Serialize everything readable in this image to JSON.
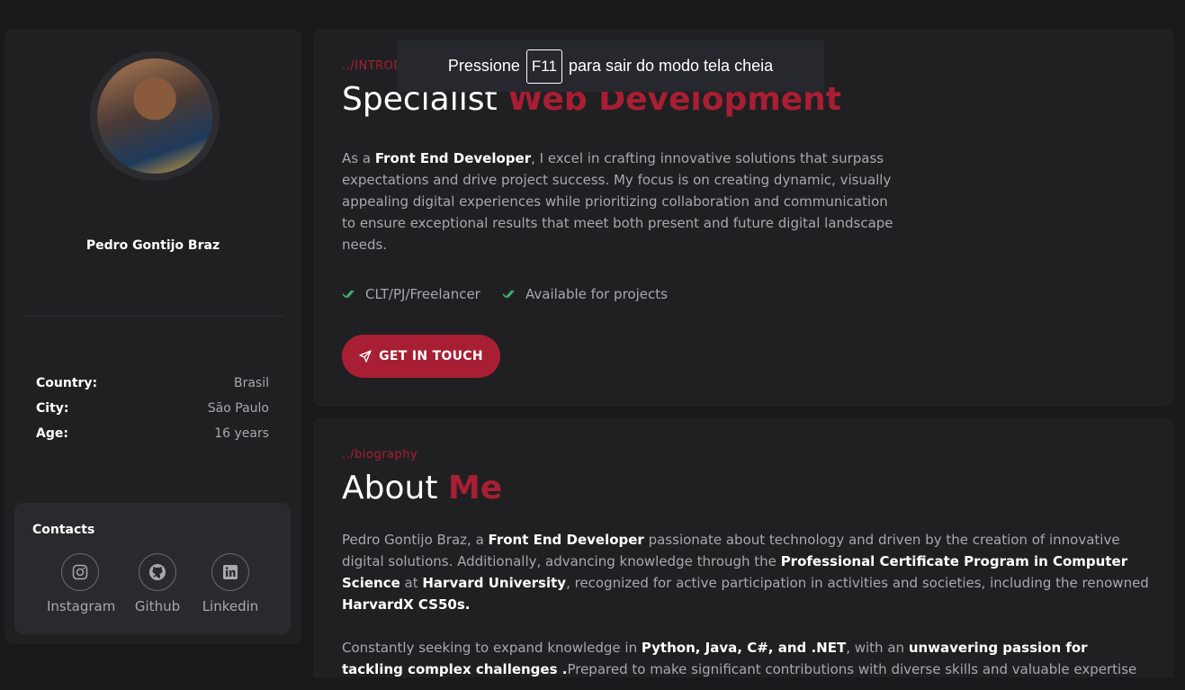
{
  "sidebar": {
    "name": "Pedro Gontijo Braz",
    "info": [
      {
        "label": "Country:",
        "value": "Brasil"
      },
      {
        "label": "City:",
        "value": "São Paulo"
      },
      {
        "label": "Age:",
        "value": "16 years"
      }
    ],
    "contacts_title": "Contacts",
    "socials": [
      {
        "label": "Instagram",
        "icon": "instagram-icon"
      },
      {
        "label": "Github",
        "icon": "github-icon"
      },
      {
        "label": "Linkedin",
        "icon": "linkedin-icon"
      }
    ]
  },
  "intro": {
    "crumb": "../INTRODUCTION",
    "heading_plain": "Specialist",
    "heading_accent": "Web Development",
    "para_1": "As a ",
    "para_bold": "Front End Developer",
    "para_2": ", I excel in crafting innovative solutions that surpass expectations and drive project success. My focus is on creating dynamic, visually appealing digital experiences while prioritizing collaboration and communication to ensure exceptional results that meet both present and future digital landscape needs.",
    "checks": [
      "CLT/PJ/Freelancer",
      "Available for projects"
    ],
    "button_label": "GET IN TOUCH"
  },
  "about": {
    "crumb": "../biography",
    "heading_plain": "About",
    "heading_accent": "Me",
    "p1_a": "Pedro Gontijo Braz, a ",
    "p1_b": "Front End Developer",
    "p1_c": " passionate about technology and driven by the creation of innovative digital solutions. Additionally, advancing knowledge through the ",
    "p1_d": "Professional Certificate Program in Computer Science",
    "p1_e": " at ",
    "p1_f": "Harvard University",
    "p1_g": ", recognized for active participation in activities and societies, including the renowned ",
    "p1_h": "HarvardX CS50s.",
    "p2_a": "Constantly seeking to expand knowledge in ",
    "p2_b": "Python, Java, C#, and .NET",
    "p2_c": ", with an ",
    "p2_d": "unwavering passion for tackling complex challenges .",
    "p2_e": "Prepared to make significant contributions with diverse skills and valuable expertise in any professional"
  },
  "toast": {
    "before": "Pressione",
    "key": "F11",
    "after": "para sair do modo tela cheia"
  },
  "colors": {
    "accent": "#a81e32",
    "check": "#3fae6a",
    "background": "#19191b",
    "card": "#202023"
  }
}
